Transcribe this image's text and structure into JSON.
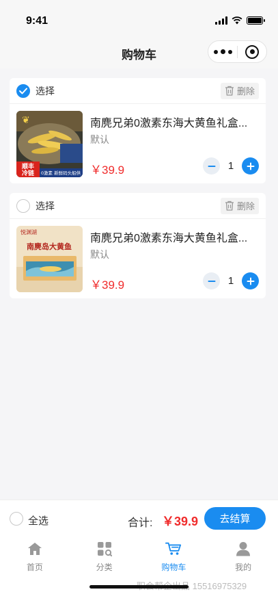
{
  "status_bar": {
    "time": "9:41"
  },
  "nav": {
    "title": "购物车"
  },
  "cart": {
    "items": [
      {
        "select_label": "选择",
        "checked": true,
        "delete_label": "删除",
        "title": "南麂兄弟0激素东海大黄鱼礼盒...",
        "spec": "默认",
        "price": "￥39.9",
        "quantity": "1",
        "image_text": {
          "badge": "顺丰冷链",
          "sub": "0激素 新鲜码头船供"
        }
      },
      {
        "select_label": "选择",
        "checked": false,
        "delete_label": "删除",
        "title": "南麂兄弟0激素东海大黄鱼礼盒...",
        "spec": "默认",
        "price": "￥39.9",
        "quantity": "1",
        "image_text": {
          "brand": "悦渊湖",
          "product": "南麂岛大黄鱼"
        }
      }
    ]
  },
  "footer": {
    "select_all_label": "全选",
    "total_label": "合计:",
    "total_value": "￥39.9",
    "checkout_label": "去结算"
  },
  "tabs": [
    {
      "label": "首页",
      "icon": "home-icon",
      "active": false
    },
    {
      "label": "分类",
      "icon": "category-icon",
      "active": false
    },
    {
      "label": "购物车",
      "icon": "cart-icon",
      "active": true
    },
    {
      "label": "我的",
      "icon": "user-icon",
      "active": false
    }
  ],
  "watermark": "职会帮企出品 15516975329",
  "colors": {
    "accent": "#1a8cf0",
    "price": "#f02c2c"
  }
}
